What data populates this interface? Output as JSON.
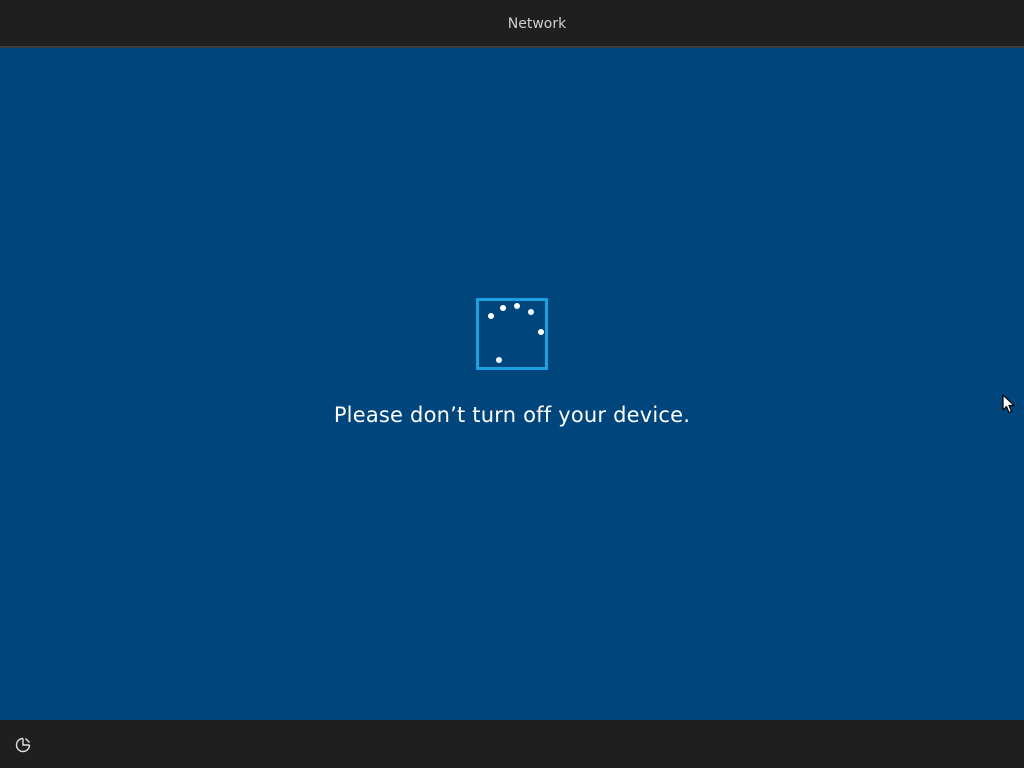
{
  "header": {
    "tab_label": "Network"
  },
  "main": {
    "message": "Please don’t turn off your device.",
    "spinner_icon": "loading-spinner-icon"
  },
  "footer": {
    "ease_of_access_icon": "ease-of-access-icon"
  },
  "colors": {
    "background": "#00457c",
    "bar": "#1f1f1f",
    "spinner_border": "#1ba1e2",
    "text": "#ffffff"
  }
}
